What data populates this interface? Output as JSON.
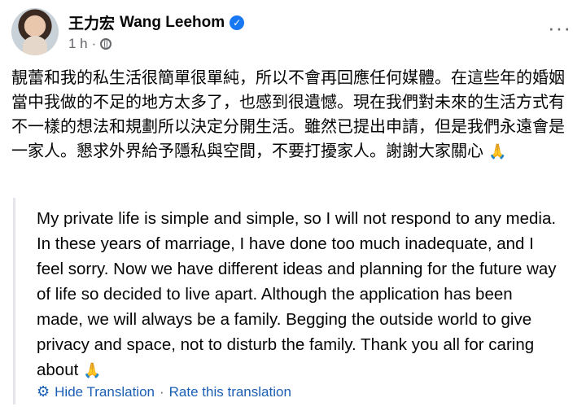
{
  "author": {
    "name_zh": "王力宏",
    "name_en": "Wang Leehom",
    "verified_icon": "verified-check-icon"
  },
  "meta": {
    "time": "1 h",
    "separator": "·",
    "audience_icon": "globe-icon"
  },
  "menu": {
    "more_label": "···"
  },
  "post": {
    "text_zh": "靚蕾和我的私生活很簡單很單純，所以不會再回應任何媒體。在這些年的婚姻當中我做的不足的地方太多了，也感到很遺憾。現在我們對未來的生活方式有不一樣的想法和規劃所以決定分開生活。雖然已提出申請，但是我們永遠會是一家人。懇求外界給予隱私與空間，不要打擾家人。謝謝大家關心",
    "emoji": "🙏"
  },
  "translation": {
    "text_en": "My private life is simple and simple, so I will not respond to any media. In these years of marriage, I have done too much inadequate, and I feel sorry. Now we have different ideas and planning for the future way of life so decided to live apart. Although the application has been made, we will always be a family. Begging the outside world to give privacy and space, not to disturb the family. Thank you all for caring about",
    "emoji": "🙏",
    "hide_label": "Hide Translation",
    "separator": "·",
    "rate_label": "Rate this translation",
    "settings_icon": "gear-icon"
  },
  "colors": {
    "link": "#1a5fb4",
    "verified": "#1877f2",
    "muted": "#65676b"
  }
}
